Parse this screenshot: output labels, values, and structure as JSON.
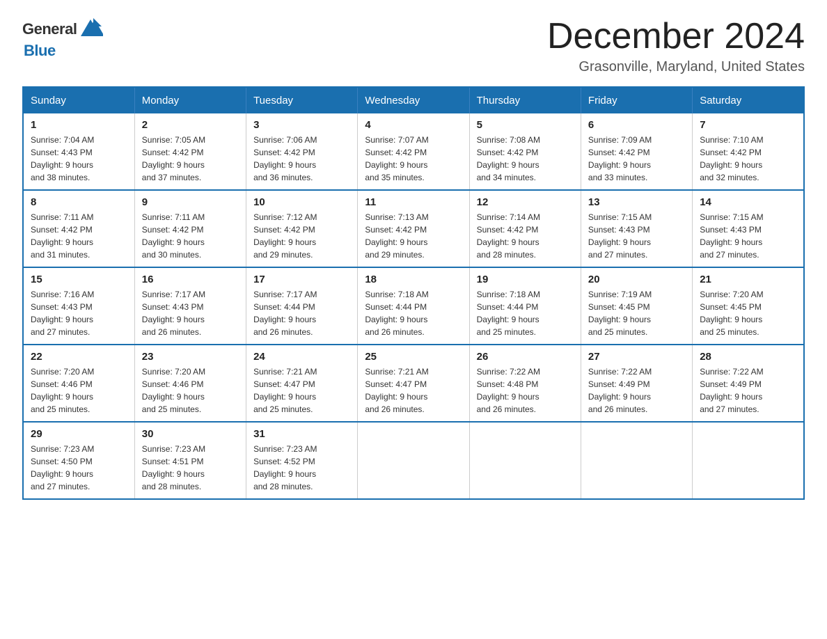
{
  "header": {
    "logo_text_general": "General",
    "logo_text_blue": "Blue",
    "month_title": "December 2024",
    "location": "Grasonville, Maryland, United States"
  },
  "calendar": {
    "days_of_week": [
      "Sunday",
      "Monday",
      "Tuesday",
      "Wednesday",
      "Thursday",
      "Friday",
      "Saturday"
    ],
    "weeks": [
      [
        {
          "day": "1",
          "sunrise": "7:04 AM",
          "sunset": "4:43 PM",
          "daylight": "9 hours and 38 minutes."
        },
        {
          "day": "2",
          "sunrise": "7:05 AM",
          "sunset": "4:42 PM",
          "daylight": "9 hours and 37 minutes."
        },
        {
          "day": "3",
          "sunrise": "7:06 AM",
          "sunset": "4:42 PM",
          "daylight": "9 hours and 36 minutes."
        },
        {
          "day": "4",
          "sunrise": "7:07 AM",
          "sunset": "4:42 PM",
          "daylight": "9 hours and 35 minutes."
        },
        {
          "day": "5",
          "sunrise": "7:08 AM",
          "sunset": "4:42 PM",
          "daylight": "9 hours and 34 minutes."
        },
        {
          "day": "6",
          "sunrise": "7:09 AM",
          "sunset": "4:42 PM",
          "daylight": "9 hours and 33 minutes."
        },
        {
          "day": "7",
          "sunrise": "7:10 AM",
          "sunset": "4:42 PM",
          "daylight": "9 hours and 32 minutes."
        }
      ],
      [
        {
          "day": "8",
          "sunrise": "7:11 AM",
          "sunset": "4:42 PM",
          "daylight": "9 hours and 31 minutes."
        },
        {
          "day": "9",
          "sunrise": "7:11 AM",
          "sunset": "4:42 PM",
          "daylight": "9 hours and 30 minutes."
        },
        {
          "day": "10",
          "sunrise": "7:12 AM",
          "sunset": "4:42 PM",
          "daylight": "9 hours and 29 minutes."
        },
        {
          "day": "11",
          "sunrise": "7:13 AM",
          "sunset": "4:42 PM",
          "daylight": "9 hours and 29 minutes."
        },
        {
          "day": "12",
          "sunrise": "7:14 AM",
          "sunset": "4:42 PM",
          "daylight": "9 hours and 28 minutes."
        },
        {
          "day": "13",
          "sunrise": "7:15 AM",
          "sunset": "4:43 PM",
          "daylight": "9 hours and 27 minutes."
        },
        {
          "day": "14",
          "sunrise": "7:15 AM",
          "sunset": "4:43 PM",
          "daylight": "9 hours and 27 minutes."
        }
      ],
      [
        {
          "day": "15",
          "sunrise": "7:16 AM",
          "sunset": "4:43 PM",
          "daylight": "9 hours and 27 minutes."
        },
        {
          "day": "16",
          "sunrise": "7:17 AM",
          "sunset": "4:43 PM",
          "daylight": "9 hours and 26 minutes."
        },
        {
          "day": "17",
          "sunrise": "7:17 AM",
          "sunset": "4:44 PM",
          "daylight": "9 hours and 26 minutes."
        },
        {
          "day": "18",
          "sunrise": "7:18 AM",
          "sunset": "4:44 PM",
          "daylight": "9 hours and 26 minutes."
        },
        {
          "day": "19",
          "sunrise": "7:18 AM",
          "sunset": "4:44 PM",
          "daylight": "9 hours and 25 minutes."
        },
        {
          "day": "20",
          "sunrise": "7:19 AM",
          "sunset": "4:45 PM",
          "daylight": "9 hours and 25 minutes."
        },
        {
          "day": "21",
          "sunrise": "7:20 AM",
          "sunset": "4:45 PM",
          "daylight": "9 hours and 25 minutes."
        }
      ],
      [
        {
          "day": "22",
          "sunrise": "7:20 AM",
          "sunset": "4:46 PM",
          "daylight": "9 hours and 25 minutes."
        },
        {
          "day": "23",
          "sunrise": "7:20 AM",
          "sunset": "4:46 PM",
          "daylight": "9 hours and 25 minutes."
        },
        {
          "day": "24",
          "sunrise": "7:21 AM",
          "sunset": "4:47 PM",
          "daylight": "9 hours and 25 minutes."
        },
        {
          "day": "25",
          "sunrise": "7:21 AM",
          "sunset": "4:47 PM",
          "daylight": "9 hours and 26 minutes."
        },
        {
          "day": "26",
          "sunrise": "7:22 AM",
          "sunset": "4:48 PM",
          "daylight": "9 hours and 26 minutes."
        },
        {
          "day": "27",
          "sunrise": "7:22 AM",
          "sunset": "4:49 PM",
          "daylight": "9 hours and 26 minutes."
        },
        {
          "day": "28",
          "sunrise": "7:22 AM",
          "sunset": "4:49 PM",
          "daylight": "9 hours and 27 minutes."
        }
      ],
      [
        {
          "day": "29",
          "sunrise": "7:23 AM",
          "sunset": "4:50 PM",
          "daylight": "9 hours and 27 minutes."
        },
        {
          "day": "30",
          "sunrise": "7:23 AM",
          "sunset": "4:51 PM",
          "daylight": "9 hours and 28 minutes."
        },
        {
          "day": "31",
          "sunrise": "7:23 AM",
          "sunset": "4:52 PM",
          "daylight": "9 hours and 28 minutes."
        },
        null,
        null,
        null,
        null
      ]
    ],
    "labels": {
      "sunrise": "Sunrise:",
      "sunset": "Sunset:",
      "daylight": "Daylight:"
    }
  }
}
